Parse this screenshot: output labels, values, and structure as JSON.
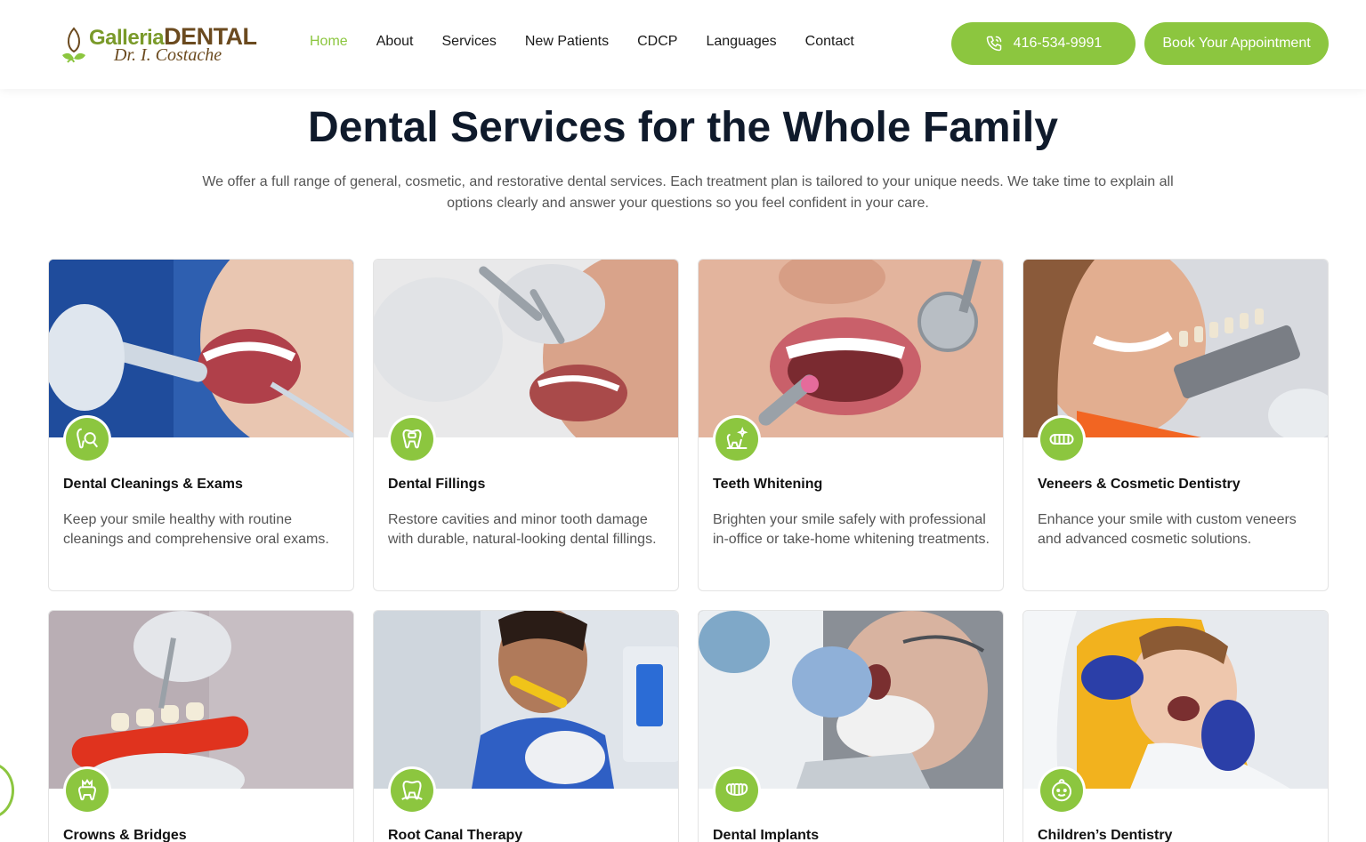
{
  "brand": {
    "name_part1": "Galleria",
    "name_part2": "DENTAL",
    "doctor": "Dr. I. Costache",
    "accent_color": "#8cc63f",
    "brown_color": "#6b4a1f"
  },
  "nav": {
    "items": [
      {
        "label": "Home",
        "active": true
      },
      {
        "label": "About"
      },
      {
        "label": "Services"
      },
      {
        "label": "New Patients"
      },
      {
        "label": "CDCP"
      },
      {
        "label": "Languages"
      },
      {
        "label": "Contact"
      }
    ]
  },
  "header": {
    "phone_label": "416-534-9991",
    "phone_icon": "phone-icon",
    "book_label": "Book Your Appointment"
  },
  "hero": {
    "title": "Dental Services for the Whole Family",
    "intro": "We offer a full range of general, cosmetic, and restorative dental services. Each treatment plan is tailored to your unique needs. We take time to explain all options clearly and answer your questions so you feel confident in your care."
  },
  "services": [
    {
      "title": "Dental Cleanings & Exams",
      "desc": "Keep your smile healthy with routine cleanings and comprehensive oral exams.",
      "icon": "tooth-magnifier-icon",
      "image": "patient-cleaning-photo"
    },
    {
      "title": "Dental Fillings",
      "desc": "Restore cavities and minor tooth damage with durable, natural-looking dental fillings.",
      "icon": "tooth-filling-icon",
      "image": "dentist-filling-photo"
    },
    {
      "title": "Teeth Whitening",
      "desc": "Brighten your smile safely with professional in-office or take-home whitening treatments.",
      "icon": "tooth-sparkle-icon",
      "image": "whitening-photo"
    },
    {
      "title": "Veneers & Cosmetic Dentistry",
      "desc": "Enhance your smile with custom veneers and advanced cosmetic solutions.",
      "icon": "veneers-icon",
      "image": "smiling-woman-shade-guide-photo"
    },
    {
      "title": "Crowns & Bridges",
      "desc": "",
      "icon": "crown-icon",
      "image": "dental-model-photo"
    },
    {
      "title": "Root Canal Therapy",
      "desc": "",
      "icon": "root-canal-icon",
      "image": "smiling-man-photo"
    },
    {
      "title": "Dental Implants",
      "desc": "",
      "icon": "implant-teeth-icon",
      "image": "elderly-patient-photo"
    },
    {
      "title": "Children’s Dentistry",
      "desc": "",
      "icon": "child-face-icon",
      "image": "child-patient-photo"
    }
  ]
}
